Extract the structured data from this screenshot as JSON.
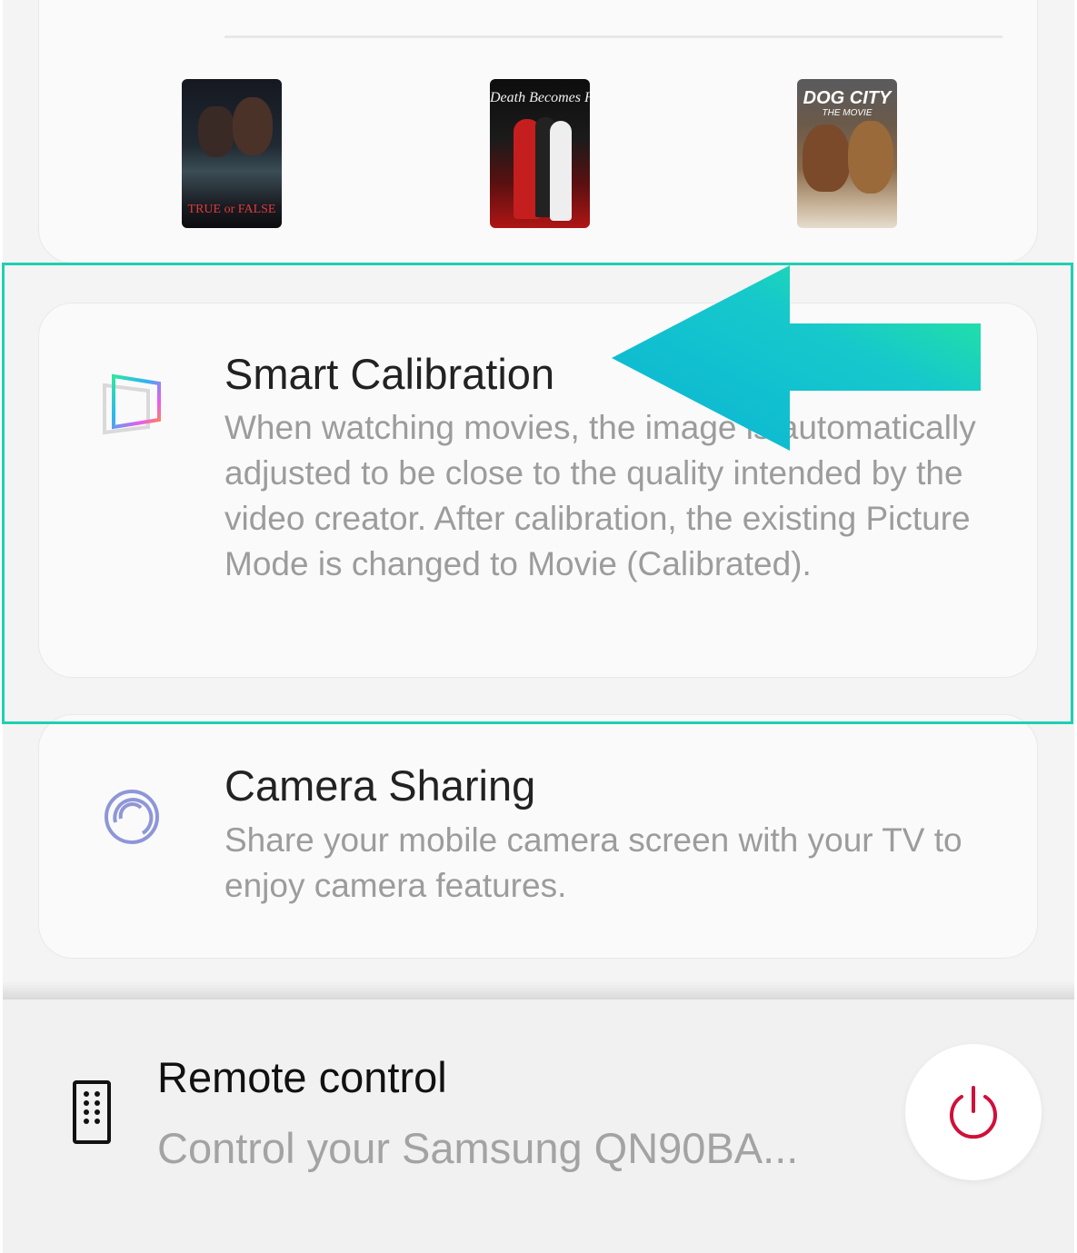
{
  "posters": [
    {
      "title": "TRUE or FALSE"
    },
    {
      "title": "Death Becomes Her"
    },
    {
      "title": "DOG CITY",
      "subtitle": "THE MOVIE"
    }
  ],
  "calibration": {
    "title": "Smart Calibration",
    "description": "When watching movies, the image is automatically adjusted to be close to the quality intended by the video creator. After calibration, the existing Picture Mode is changed to Movie (Calibrated)."
  },
  "camera": {
    "title": "Camera Sharing",
    "description": "Share your mobile camera screen with your TV to enjoy camera features."
  },
  "remote": {
    "title": "Remote control",
    "subtitle": "Control your Samsung QN90BA..."
  },
  "icons": {
    "calibration": "smart-calibration-icon",
    "camera": "camera-sharing-icon",
    "remote": "remote-control-icon",
    "power": "power-icon"
  },
  "colors": {
    "highlight": "#1fcfb3",
    "power": "#d0103a",
    "title_text": "#222222",
    "desc_text": "#9c9c9c"
  }
}
